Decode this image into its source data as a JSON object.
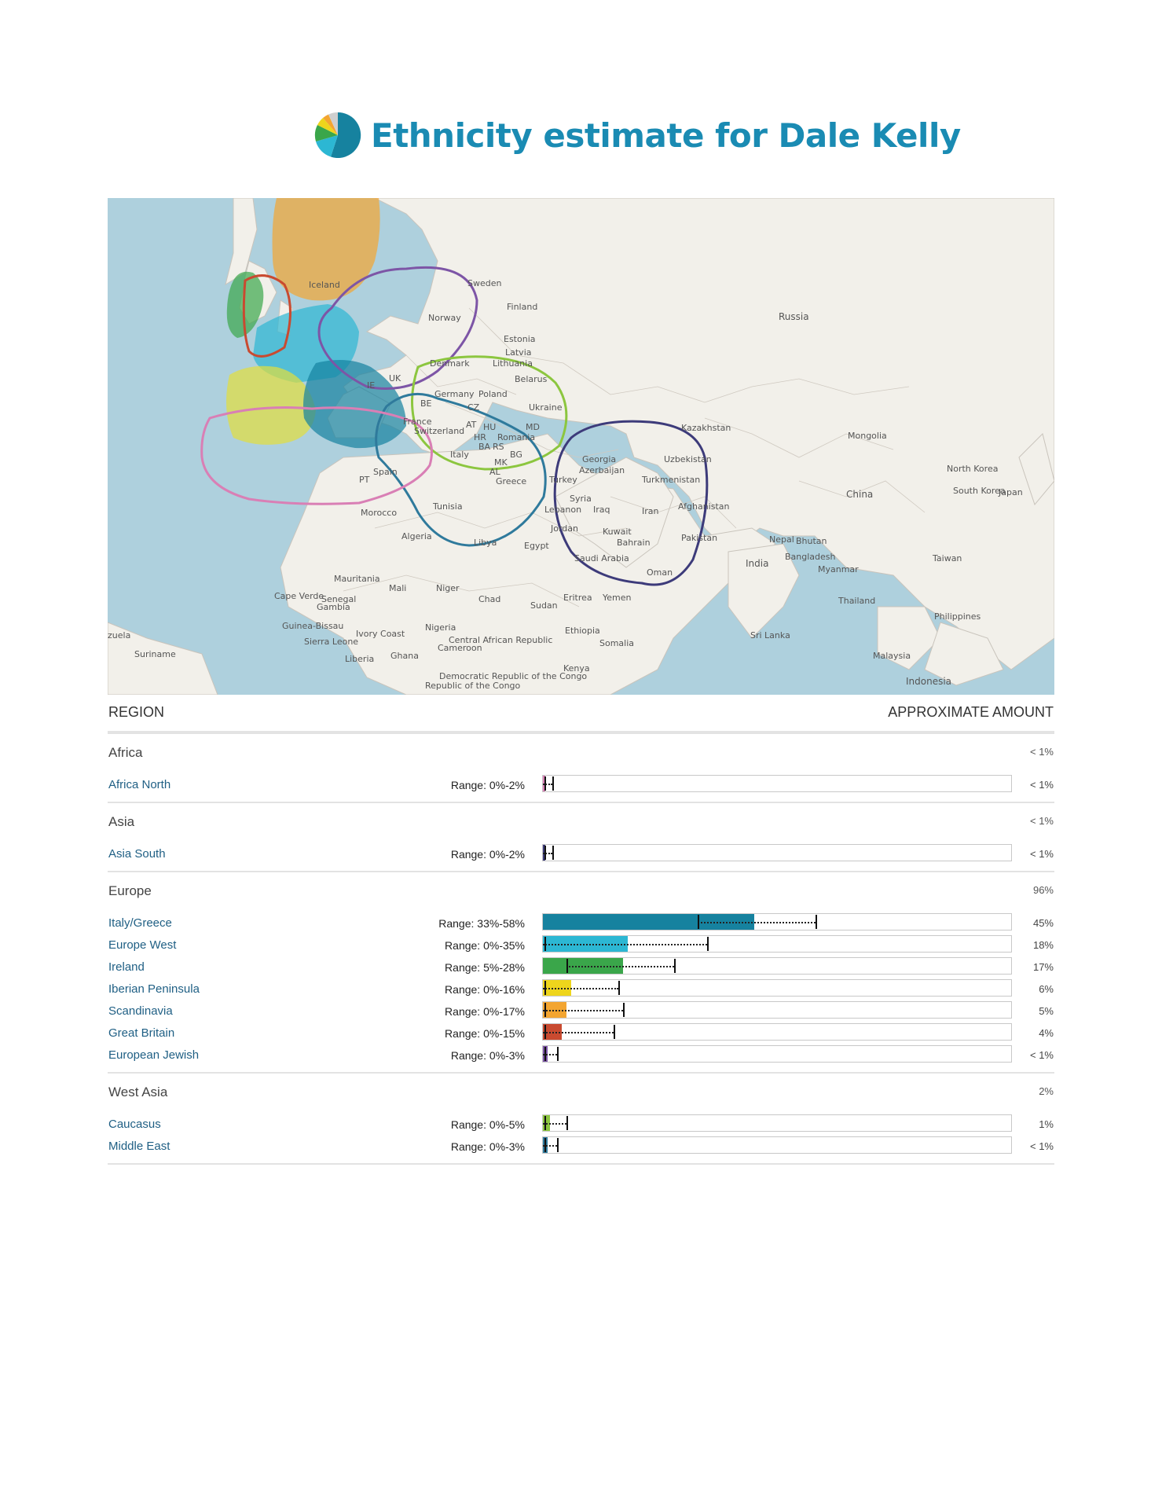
{
  "title": "Ethnicity estimate for Dale Kelly",
  "map": {
    "labels": [
      {
        "text": "Iceland"
      },
      {
        "text": "Sweden"
      },
      {
        "text": "Finland"
      },
      {
        "text": "Norway"
      },
      {
        "text": "Russia"
      },
      {
        "text": "Estonia"
      },
      {
        "text": "Latvia"
      },
      {
        "text": "Lithuania"
      },
      {
        "text": "Denmark"
      },
      {
        "text": "UK"
      },
      {
        "text": "IE"
      },
      {
        "text": "Belarus"
      },
      {
        "text": "Germany"
      },
      {
        "text": "Poland"
      },
      {
        "text": "BE"
      },
      {
        "text": "CZ"
      },
      {
        "text": "Ukraine"
      },
      {
        "text": "France"
      },
      {
        "text": "AT"
      },
      {
        "text": "HU"
      },
      {
        "text": "MD"
      },
      {
        "text": "Switzerland"
      },
      {
        "text": "HR"
      },
      {
        "text": "Romania"
      },
      {
        "text": "BA"
      },
      {
        "text": "RS"
      },
      {
        "text": "Italy"
      },
      {
        "text": "BG"
      },
      {
        "text": "MK"
      },
      {
        "text": "AL"
      },
      {
        "text": "Greece"
      },
      {
        "text": "Spain"
      },
      {
        "text": "PT"
      },
      {
        "text": "Kazakhstan"
      },
      {
        "text": "Mongolia"
      },
      {
        "text": "Georgia"
      },
      {
        "text": "Uzbekistan"
      },
      {
        "text": "Azerbaijan"
      },
      {
        "text": "Turkmenistan"
      },
      {
        "text": "Turkey"
      },
      {
        "text": "North Korea"
      },
      {
        "text": "South Korea"
      },
      {
        "text": "Japan"
      },
      {
        "text": "China"
      },
      {
        "text": "Tunisia"
      },
      {
        "text": "Syria"
      },
      {
        "text": "Lebanon"
      },
      {
        "text": "Iraq"
      },
      {
        "text": "Iran"
      },
      {
        "text": "Afghanistan"
      },
      {
        "text": "Morocco"
      },
      {
        "text": "Jordan"
      },
      {
        "text": "Kuwait"
      },
      {
        "text": "Bahrain"
      },
      {
        "text": "Algeria"
      },
      {
        "text": "Libya"
      },
      {
        "text": "Egypt"
      },
      {
        "text": "Pakistan"
      },
      {
        "text": "Nepal"
      },
      {
        "text": "Bhutan"
      },
      {
        "text": "Saudi Arabia"
      },
      {
        "text": "Bangladesh"
      },
      {
        "text": "India"
      },
      {
        "text": "Myanmar"
      },
      {
        "text": "Taiwan"
      },
      {
        "text": "Oman"
      },
      {
        "text": "Mauritania"
      },
      {
        "text": "Mali"
      },
      {
        "text": "Niger"
      },
      {
        "text": "Cape Verde"
      },
      {
        "text": "Senegal"
      },
      {
        "text": "Gambia"
      },
      {
        "text": "Chad"
      },
      {
        "text": "Sudan"
      },
      {
        "text": "Eritrea"
      },
      {
        "text": "Yemen"
      },
      {
        "text": "Thailand"
      },
      {
        "text": "Guinea-Bissau"
      },
      {
        "text": "Nigeria"
      },
      {
        "text": "Ethiopia"
      },
      {
        "text": "Philippines"
      },
      {
        "text": "Ivory Coast"
      },
      {
        "text": "zuela"
      },
      {
        "text": "Sierra Leone"
      },
      {
        "text": "Central African Republic"
      },
      {
        "text": "Cameroon"
      },
      {
        "text": "Somalia"
      },
      {
        "text": "Sri Lanka"
      },
      {
        "text": "Suriname"
      },
      {
        "text": "Liberia"
      },
      {
        "text": "Ghana"
      },
      {
        "text": "Malaysia"
      },
      {
        "text": "Kenya"
      },
      {
        "text": "Democratic Republic of the Congo"
      },
      {
        "text": "Republic of the Congo"
      },
      {
        "text": "Indonesia"
      }
    ]
  },
  "table": {
    "header_left": "REGION",
    "header_right": "APPROXIMATE AMOUNT",
    "groups": [
      {
        "name": "Africa",
        "pct": "< 1%",
        "rows": [
          {
            "name": "Africa North",
            "range": "Range: 0%-2%",
            "amount": "< 1%",
            "value": 0.5,
            "low": 0,
            "high": 2,
            "color": "#d97fb5"
          }
        ]
      },
      {
        "name": "Asia",
        "pct": "< 1%",
        "rows": [
          {
            "name": "Asia South",
            "range": "Range: 0%-2%",
            "amount": "< 1%",
            "value": 0.5,
            "low": 0,
            "high": 2,
            "color": "#3d3b7a"
          }
        ]
      },
      {
        "name": "Europe",
        "pct": "96%",
        "rows": [
          {
            "name": "Italy/Greece",
            "range": "Range: 33%-58%",
            "amount": "45%",
            "value": 45,
            "low": 33,
            "high": 58,
            "color": "#16829f"
          },
          {
            "name": "Europe West",
            "range": "Range: 0%-35%",
            "amount": "18%",
            "value": 18,
            "low": 0,
            "high": 35,
            "color": "#2cb7d3"
          },
          {
            "name": "Ireland",
            "range": "Range: 5%-28%",
            "amount": "17%",
            "value": 17,
            "low": 5,
            "high": 28,
            "color": "#3aa64a"
          },
          {
            "name": "Iberian Peninsula",
            "range": "Range: 0%-16%",
            "amount": "6%",
            "value": 6,
            "low": 0,
            "high": 16,
            "color": "#eed51c"
          },
          {
            "name": "Scandinavia",
            "range": "Range: 0%-17%",
            "amount": "5%",
            "value": 5,
            "low": 0,
            "high": 17,
            "color": "#f3a531"
          },
          {
            "name": "Great Britain",
            "range": "Range: 0%-15%",
            "amount": "4%",
            "value": 4,
            "low": 0,
            "high": 15,
            "color": "#c94a30"
          },
          {
            "name": "European Jewish",
            "range": "Range: 0%-3%",
            "amount": "< 1%",
            "value": 1,
            "low": 0,
            "high": 3,
            "color": "#7d55a6"
          }
        ]
      },
      {
        "name": "West Asia",
        "pct": "2%",
        "rows": [
          {
            "name": "Caucasus",
            "range": "Range: 0%-5%",
            "amount": "1%",
            "value": 1.5,
            "low": 0,
            "high": 5,
            "color": "#8cc63f"
          },
          {
            "name": "Middle East",
            "range": "Range: 0%-3%",
            "amount": "< 1%",
            "value": 1,
            "low": 0,
            "high": 3,
            "color": "#2f7a9c"
          }
        ]
      }
    ]
  }
}
